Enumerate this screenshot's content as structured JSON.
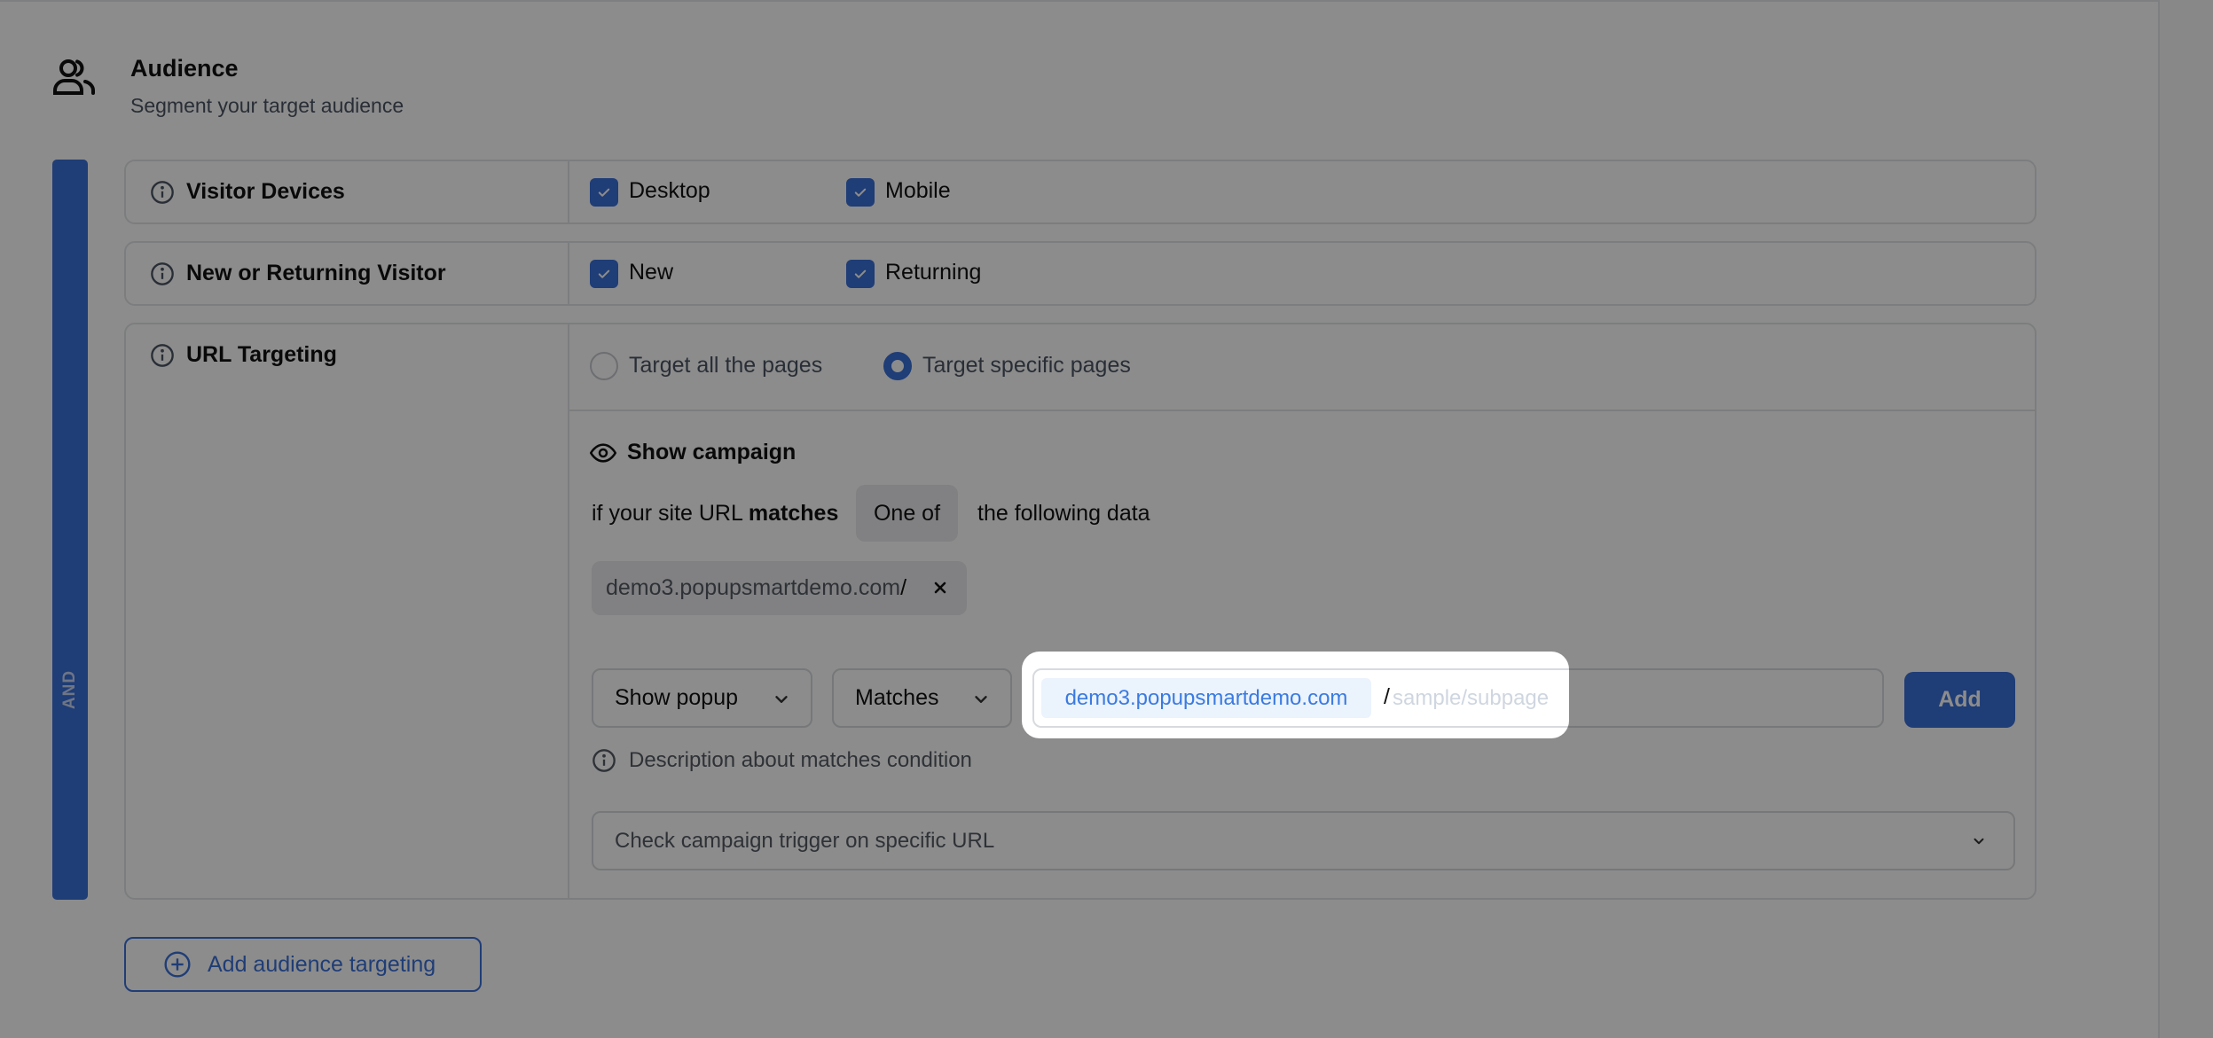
{
  "header": {
    "icon": "users-icon",
    "title": "Audience",
    "subtitle": "Segment your target audience"
  },
  "group": {
    "operator_label": "AND",
    "accent_color": "#3a6fd8"
  },
  "rules": [
    {
      "label": "Visitor Devices",
      "icon": "info-icon",
      "options": [
        {
          "label": "Desktop",
          "checked": true
        },
        {
          "label": "Mobile",
          "checked": true
        }
      ]
    },
    {
      "label": "New or Returning Visitor",
      "icon": "info-icon",
      "options": [
        {
          "label": "New",
          "checked": true
        },
        {
          "label": "Returning",
          "checked": true
        }
      ]
    },
    {
      "label": "URL Targeting",
      "icon": "info-icon",
      "radio_options": [
        {
          "label": "Target all the pages",
          "selected": false
        },
        {
          "label": "Target specific pages",
          "selected": true
        }
      ],
      "show_campaign": {
        "icon": "eye-icon",
        "label": "Show campaign"
      },
      "condition": {
        "prefix": "if your site URL ",
        "keyword": "matches",
        "operator": "One of",
        "suffix": "the following data"
      },
      "chips": [
        {
          "domain": "demo3.popupsmartdemo.com",
          "path": "/",
          "remove_icon": "close-icon"
        }
      ],
      "controls": {
        "action_select": "Show popup",
        "match_select": "Matches",
        "url_prefix": "demo3.popupsmartdemo.com",
        "url_separator": "/",
        "url_value": "",
        "url_placeholder": "sample/subpage",
        "add_label": "Add"
      },
      "description": "Description about matches condition",
      "trigger_select": "Check campaign trigger on specific URL"
    }
  ],
  "footer": {
    "add_targeting_label": "Add audience targeting",
    "add_targeting_icon": "plus-circle-icon"
  },
  "overlay": {
    "highlighted_element": "url-input"
  }
}
